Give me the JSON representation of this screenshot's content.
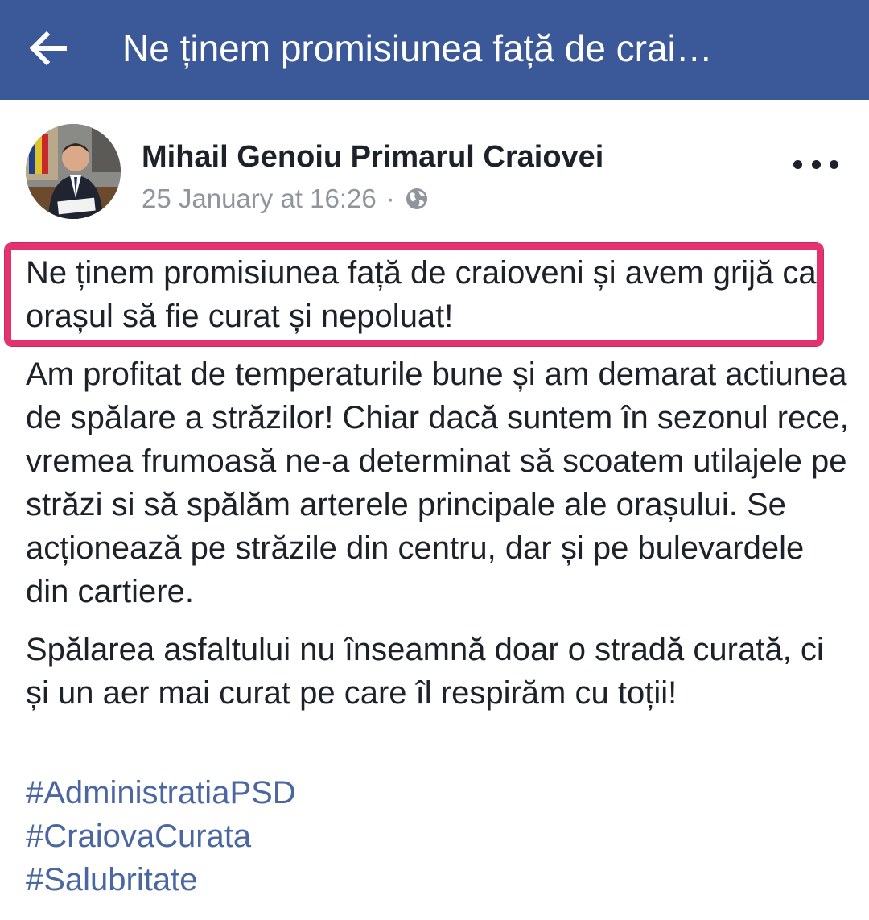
{
  "header": {
    "title": "Ne ținem promisiunea față de crai…",
    "back_icon": "arrow-left-icon",
    "background": "#3b5998"
  },
  "post": {
    "author": "Mihail Genoiu Primarul Craiovei",
    "timestamp": "25 January at 16:26",
    "separator": "·",
    "privacy_icon": "globe-icon",
    "more_icon": "more-dots-icon",
    "highlight_color": "#e4326f",
    "paragraphs": [
      "Ne ținem promisiunea față de craioveni și avem grijă ca orașul să fie curat și nepoluat!",
      "Am profitat de temperaturile bune și am demarat actiunea de spălare a străzilor! Chiar dacă suntem în sezonul rece, vremea frumoasă ne-a determinat să scoatem utilajele pe străzi si să spălăm arterele principale ale orașului. Se acționează pe străzile din centru, dar și pe bulevardele din cartiere.",
      "Spălarea asfaltului nu înseamnă doar o stradă curată, ci și un aer mai curat pe care îl respirăm cu toții!"
    ],
    "hashtags": [
      "#AdministratiaPSD",
      "#CraiovaCurata",
      "#Salubritate"
    ],
    "hashtag_color": "#4b67a1"
  }
}
